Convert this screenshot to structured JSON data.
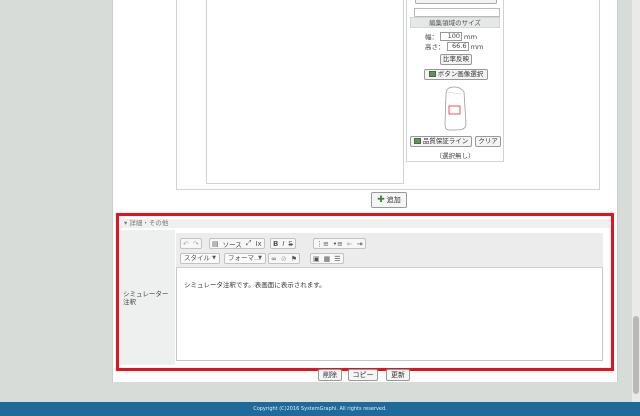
{
  "panel": {
    "edit_area_title": "編集領域のサイズ",
    "width_label": "幅：",
    "width_value": "100",
    "width_unit": "ｍｍ",
    "height_label": "高さ：",
    "height_value": "66.6",
    "height_unit": "ｍｍ",
    "ratio_button": "比率反映",
    "select_image_button": "ボタン画像選択",
    "quality_line_button": "品質保証ライン",
    "clear_button": "クリア",
    "none_selected": "（選択無し）"
  },
  "add_button": "追加",
  "section": {
    "header": "▾ 詳細・その他",
    "simulator_label": "シミュレーター注釈"
  },
  "editor": {
    "source_label": "ソース",
    "style_combo": "スタイル",
    "format_combo": "フォーマ...",
    "content": "シミュレータ注釈です。表画面に表示されます。"
  },
  "bottom_buttons": {
    "delete": "削除",
    "copy": "コピー",
    "update": "更新"
  },
  "footer": "Copyright (C)2016 SystemGraphi. All rights reserved.",
  "colors": {
    "highlight": "#e8101a",
    "footer": "#1e6a9a"
  }
}
